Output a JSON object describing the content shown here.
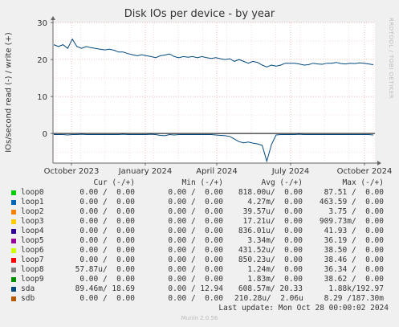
{
  "page": {
    "title": "Disk IOs per device - by year",
    "side_label": "RRDTOOL / TOBI OETIKER",
    "last_update": "Last update: Mon Oct 28 00:00:02 2024",
    "footer": "Munin 2.0.56"
  },
  "legend": {
    "headers": [
      "Cur (-/+)",
      "Min (-/+)",
      "Avg (-/+)",
      "Max (-/+)"
    ],
    "rows": [
      {
        "name": "loop0",
        "color": "#00cc00",
        "cur": "0.00 /  0.00",
        "min": "0.00 /  0.00",
        "avg": "818.00u/  0.00",
        "max": "87.51 /  0.00"
      },
      {
        "name": "loop1",
        "color": "#0066b3",
        "cur": "0.00 /  0.00",
        "min": "0.00 /  0.00",
        "avg": "4.27m/  0.00",
        "max": "463.59 /  0.00"
      },
      {
        "name": "loop2",
        "color": "#ff8000",
        "cur": "0.00 /  0.00",
        "min": "0.00 /  0.00",
        "avg": "39.57u/  0.00",
        "max": "3.75 /  0.00"
      },
      {
        "name": "loop3",
        "color": "#ffcc00",
        "cur": "0.00 /  0.00",
        "min": "0.00 /  0.00",
        "avg": "17.21u/  0.00",
        "max": "909.73m/  0.00"
      },
      {
        "name": "loop4",
        "color": "#330099",
        "cur": "0.00 /  0.00",
        "min": "0.00 /  0.00",
        "avg": "836.01u/  0.00",
        "max": "41.93 /  0.00"
      },
      {
        "name": "loop5",
        "color": "#990099",
        "cur": "0.00 /  0.00",
        "min": "0.00 /  0.00",
        "avg": "3.34m/  0.00",
        "max": "36.19 /  0.00"
      },
      {
        "name": "loop6",
        "color": "#ccff00",
        "cur": "0.00 /  0.00",
        "min": "0.00 /  0.00",
        "avg": "431.52u/  0.00",
        "max": "38.50 /  0.00"
      },
      {
        "name": "loop7",
        "color": "#ff0000",
        "cur": "0.00 /  0.00",
        "min": "0.00 /  0.00",
        "avg": "850.23u/  0.00",
        "max": "38.46 /  0.00"
      },
      {
        "name": "loop8",
        "color": "#808080",
        "cur": "57.87u/  0.00",
        "min": "0.00 /  0.00",
        "avg": "1.24m/  0.00",
        "max": "36.34 /  0.00"
      },
      {
        "name": "loop9",
        "color": "#008f00",
        "cur": "0.00 /  0.00",
        "min": "0.00 /  0.00",
        "avg": "1.83m/  0.00",
        "max": "38.62 /  0.00"
      },
      {
        "name": "sda",
        "color": "#00487d",
        "cur": "89.46m/ 18.69",
        "min": "0.00 / 12.94",
        "avg": "608.57m/ 20.33",
        "max": "1.88k/192.97"
      },
      {
        "name": "sdb",
        "color": "#b35a00",
        "cur": "0.00 /  0.00",
        "min": "0.00 /  0.00",
        "avg": "210.28u/  2.06u",
        "max": "8.29 /187.30m"
      }
    ]
  },
  "chart_data": {
    "type": "line",
    "title": "Disk IOs per device - by year",
    "ylabel": "IOs/second read (-) / write (+)",
    "xlabel": "",
    "ylim": [
      -8,
      30
    ],
    "yticks": [
      0,
      10,
      20,
      30
    ],
    "xticks": [
      "October 2023",
      "January 2024",
      "April 2024",
      "July 2024",
      "October 2024"
    ],
    "grid": true,
    "series": [
      {
        "name": "sda",
        "color": "#00487d",
        "write_values": [
          24,
          23.5,
          24,
          23,
          25.5,
          23.5,
          23,
          23.5,
          23.2,
          23,
          22.8,
          22.6,
          22.8,
          22.5,
          22,
          22,
          21.6,
          21.3,
          21,
          21.3,
          21,
          20.8,
          20.5,
          21,
          21.2,
          21.5,
          20.8,
          20.5,
          20.8,
          20.6,
          20.8,
          20.5,
          20.8,
          20.5,
          20.3,
          20.5,
          20.2,
          20,
          20.2,
          19.5,
          20,
          19.5,
          19,
          19.5,
          19.2,
          18.5,
          18,
          18.5,
          18.2,
          18.5,
          19,
          19,
          19,
          18.8,
          18.5,
          18.6,
          19,
          18.8,
          18.7,
          19,
          19,
          19.2,
          18.9,
          18.8,
          19,
          18.9,
          19.1,
          19,
          18.8,
          18.6
        ],
        "read_values": [
          -0.3,
          -0.3,
          -0.3,
          -0.4,
          -0.3,
          -0.3,
          -0.2,
          -0.3,
          -0.3,
          -0.3,
          -0.3,
          -0.3,
          -0.3,
          -0.3,
          -0.3,
          -0.2,
          -0.3,
          -0.3,
          -0.3,
          -0.3,
          -0.3,
          -0.2,
          -0.3,
          -0.5,
          -0.6,
          -0.3,
          -0.4,
          -0.3,
          -0.3,
          -0.3,
          -0.3,
          -0.3,
          -0.3,
          -0.3,
          -0.3,
          -0.4,
          -0.5,
          -0.6,
          -0.8,
          -1.5,
          -2.2,
          -2.5,
          -2.3,
          -2.6,
          -2.8,
          -3.2,
          -7.5,
          -3,
          -0.4,
          -0.3,
          -0.3,
          -0.3,
          -0.3,
          -0.2,
          -0.3,
          -0.3,
          -0.3,
          -0.3,
          -0.3,
          -0.3,
          -0.3,
          -0.3,
          -0.3,
          -0.3,
          -0.3,
          -0.3,
          -0.3,
          -0.3,
          -0.3,
          -0.4
        ]
      }
    ]
  }
}
